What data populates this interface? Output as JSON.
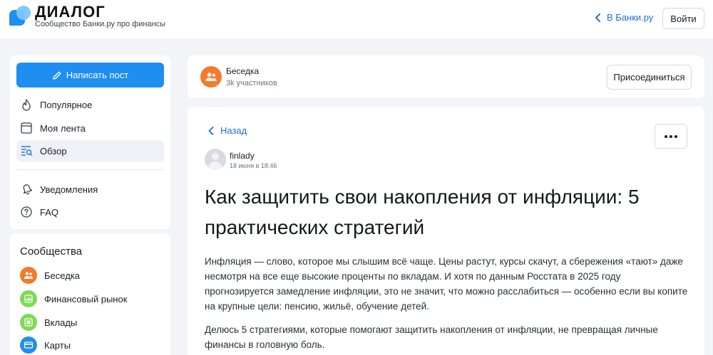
{
  "header": {
    "brand": "ДИАЛОГ",
    "tagline": "Сообщество Банки.ру про финансы",
    "to_banki": "В Банки.ру",
    "login": "Войти"
  },
  "sidebar": {
    "write_post": "Написать пост",
    "nav": [
      {
        "label": "Популярное",
        "icon": "fire-icon"
      },
      {
        "label": "Моя лента",
        "icon": "feed-icon"
      },
      {
        "label": "Обзор",
        "icon": "explore-icon",
        "active": true
      },
      {
        "label": "Уведомления",
        "icon": "bell-icon"
      },
      {
        "label": "FAQ",
        "icon": "question-icon"
      }
    ],
    "communities_title": "Сообщества",
    "communities": [
      {
        "label": "Беседка",
        "color": "#f47a2b",
        "icon": "people-icon"
      },
      {
        "label": "Финансовый рынок",
        "color": "#7ed957",
        "icon": "chart-icon"
      },
      {
        "label": "Вклады",
        "color": "#7ed957",
        "icon": "safe-icon"
      },
      {
        "label": "Карты",
        "color": "#1f8ef1",
        "icon": "card-icon"
      }
    ]
  },
  "community": {
    "name": "Беседка",
    "members": "3k участников",
    "join": "Присоединиться"
  },
  "post": {
    "back": "Назад",
    "author": "finlady",
    "date": "18 июня в 18:46",
    "title": "Как защитить свои накопления от инфляции: 5 практических стратегий",
    "paragraphs": [
      "Инфляция — слово, которое мы слышим всё чаще. Цены растут, курсы скачут, а сбережения «тают» даже несмотря на все еще высокие проценты по вкладам. И хотя по данным Росстата в 2025 году прогнозируется замедление инфляции, это не значит, что можно расслабиться — особенно если вы копите на крупные цели: пенсию, жильё, обучение детей.",
      "Делюсь 5 стратегиями, которые помогают защитить накопления от инфляции, не превращая личные финансы в головную боль."
    ]
  },
  "colors": {
    "accent": "#1f8ef1",
    "link": "#1e6fd9",
    "community_avatar": "#f47a2b"
  }
}
